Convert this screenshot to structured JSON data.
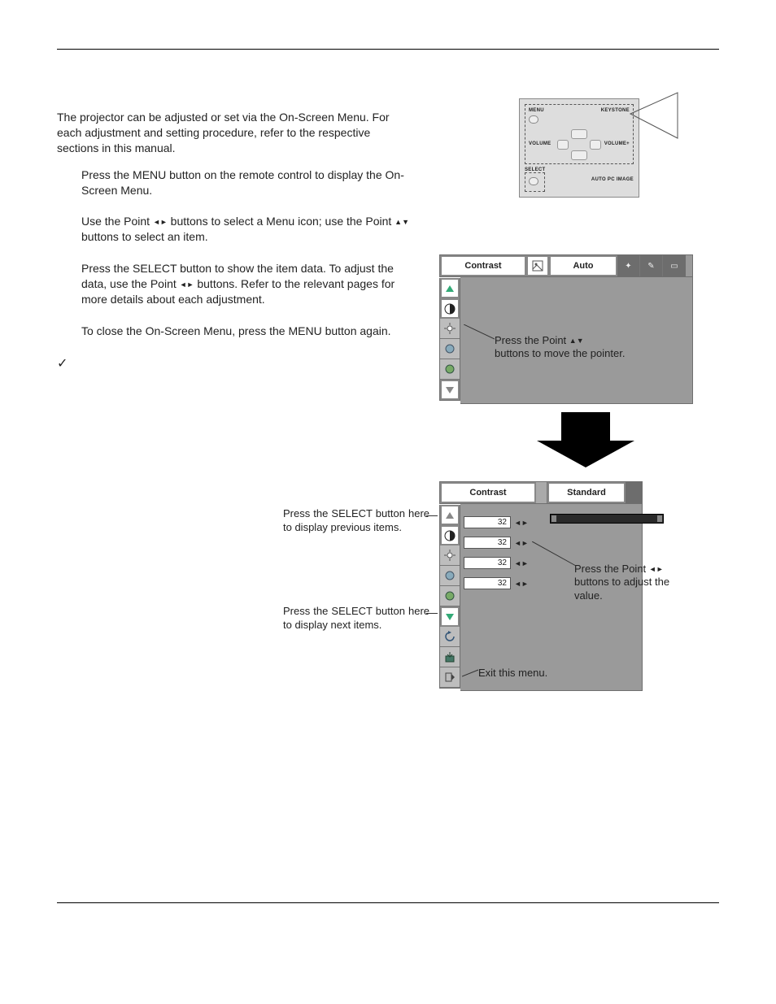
{
  "intro": "The projector can be adjusted or set via the On-Screen Menu. For each adjustment and setting procedure, refer to the respective sections in this manual.",
  "steps": {
    "s1": "Press the MENU button on the remote control to display the On-Screen Menu.",
    "s2a": "Use the Point ",
    "s2b": " buttons to select a Menu icon; use the Point ",
    "s2c": " buttons to select an item.",
    "s3a": "Press the SELECT button to show the item data. To adjust the data, use the Point ",
    "s3b": " buttons. Refer to the relevant pages for more details about each adjustment.",
    "s4": "To close the On-Screen Menu, press the MENU button again."
  },
  "panel": {
    "menu": "MENU",
    "keystone": "KEYSTONE",
    "volume": "VOLUME",
    "volumep": "VOLUME+",
    "select": "SELECT",
    "autopc": "AUTO PC IMAGE"
  },
  "osd1": {
    "title": "Contrast",
    "mode": "Auto",
    "note_a": "Press the Point ",
    "note_b": " buttons to move the pointer."
  },
  "osd2": {
    "title": "Contrast",
    "mode": "Standard",
    "values": [
      "32",
      "32",
      "32",
      "32"
    ],
    "prev": "Press the SELECT button here to display previous items.",
    "next": "Press the SELECT button here to display next items.",
    "adjust_a": "Press the Point ",
    "adjust_b": " buttons to adjust the value.",
    "exit": "Exit this menu."
  },
  "check": "✓"
}
